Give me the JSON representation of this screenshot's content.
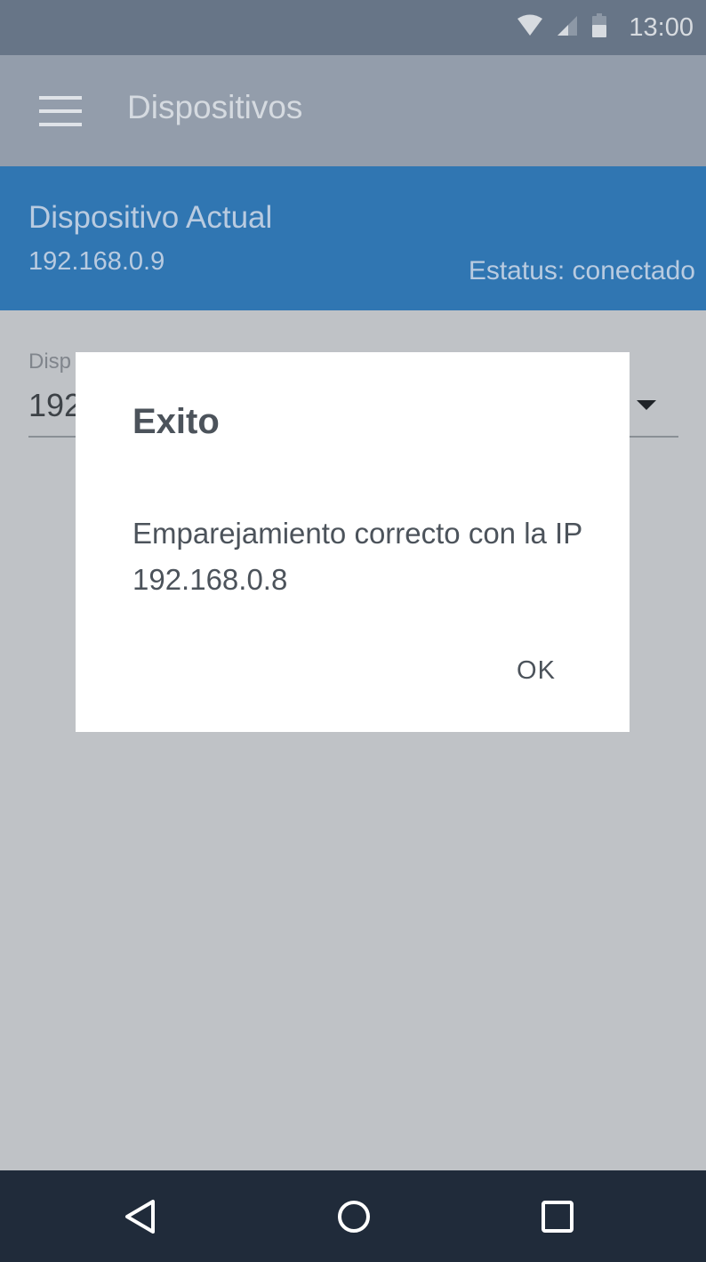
{
  "status_bar": {
    "time": "13:00",
    "icons": [
      "wifi-icon",
      "cellular-signal-icon",
      "battery-icon"
    ]
  },
  "app_bar": {
    "title": "Dispositivos",
    "menu_icon": "hamburger-menu-icon"
  },
  "current_device": {
    "title": "Dispositivo Actual",
    "ip": "192.168.0.9",
    "status": "Estatus: conectado"
  },
  "device_select": {
    "label_partial": "Disp",
    "value_partial": "192",
    "arrow_icon": "dropdown-arrow-icon"
  },
  "dialog": {
    "title": "Exito",
    "message": "Emparejamiento correcto con la IP 192.168.0.8",
    "ok_label": "OK"
  },
  "nav_bar": {
    "icons": [
      "back-icon",
      "home-icon",
      "recents-icon"
    ]
  },
  "colors": {
    "status_bar": "#677587",
    "app_bar": "#939dab",
    "device_panel": "#3076b2",
    "scrim_background": "#bfc2c6",
    "dialog": "#ffffff",
    "nav_bar": "#202b3a"
  }
}
